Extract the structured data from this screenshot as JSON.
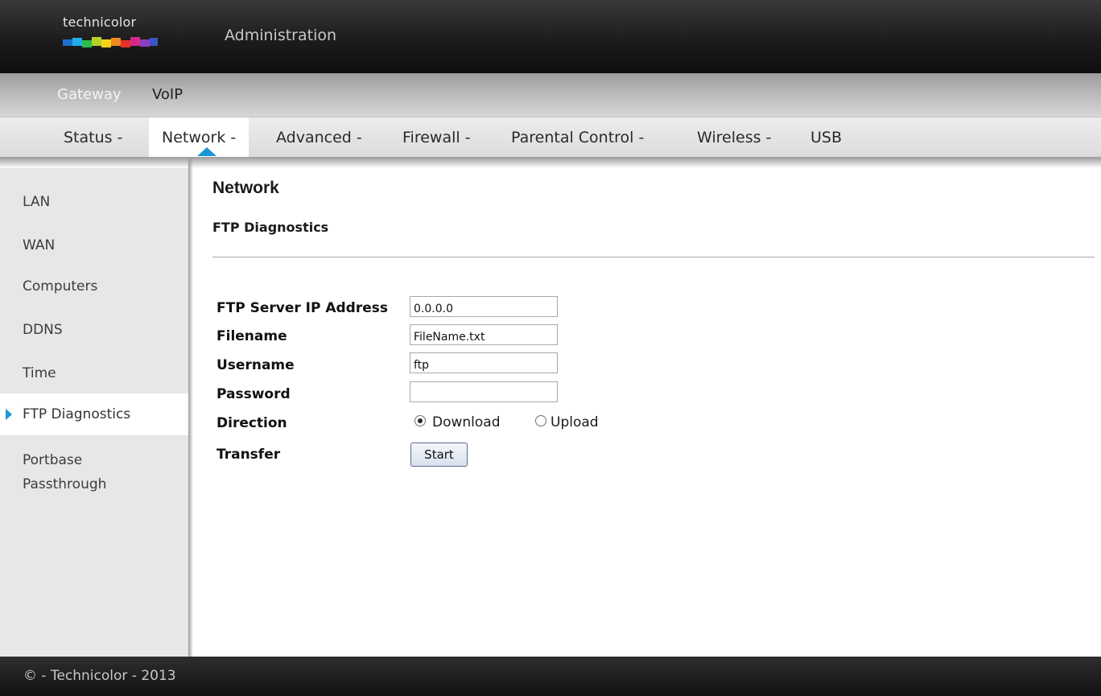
{
  "header": {
    "logo_text": "technicolor",
    "app_title": "Administration"
  },
  "nav_primary": [
    {
      "label": "Gateway",
      "active": true
    },
    {
      "label": "VoIP",
      "active": false
    }
  ],
  "nav_secondary": [
    {
      "label": "Status -",
      "active": false
    },
    {
      "label": "Network -",
      "active": true
    },
    {
      "label": "Advanced -",
      "active": false
    },
    {
      "label": "Firewall -",
      "active": false
    },
    {
      "label": "Parental Control -",
      "active": false
    },
    {
      "label": "Wireless -",
      "active": false
    },
    {
      "label": "USB",
      "active": false
    }
  ],
  "sidebar": [
    {
      "label": "LAN",
      "active": false
    },
    {
      "label": "WAN",
      "active": false
    },
    {
      "label": "Computers",
      "active": false
    },
    {
      "label": "DDNS",
      "active": false
    },
    {
      "label": "Time",
      "active": false
    },
    {
      "label": "FTP Diagnostics",
      "active": true
    },
    {
      "label": "Portbase",
      "label2": "Passthrough",
      "active": false
    }
  ],
  "main": {
    "title": "Network",
    "section": "FTP Diagnostics",
    "form": {
      "server_ip": {
        "label": "FTP Server IP Address",
        "value": "0.0.0.0"
      },
      "filename": {
        "label": "Filename",
        "value": "FileName.txt"
      },
      "username": {
        "label": "Username",
        "value": "ftp"
      },
      "password": {
        "label": "Password",
        "value": ""
      },
      "direction": {
        "label": "Direction",
        "options": [
          "Download",
          "Upload"
        ],
        "selected": "Download"
      },
      "transfer": {
        "label": "Transfer",
        "button": "Start"
      }
    }
  },
  "footer": {
    "text": "© - Technicolor - 2013"
  },
  "colors": {
    "accent": "#1a96d8"
  }
}
